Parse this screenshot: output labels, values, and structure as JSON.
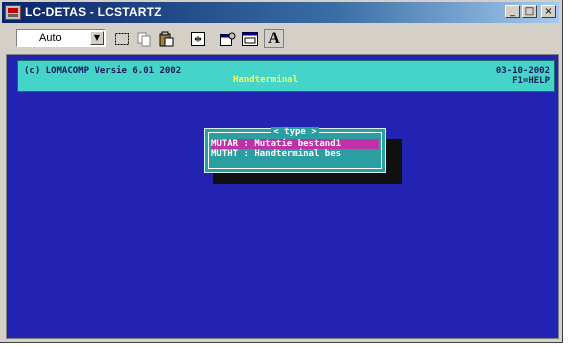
{
  "window": {
    "title": "LC-DETAS - LCSTARTZ",
    "minimize_label": "_",
    "maximize_label": "□",
    "close_label": "×"
  },
  "toolbar": {
    "font_size_value": "Auto",
    "combo_arrow": "▼",
    "buttons": [
      "select-icon",
      "copy-icon",
      "paste-icon",
      "fullscreen-icon",
      "properties-icon",
      "background-icon",
      "font-icon"
    ],
    "font_label": "A"
  },
  "header": {
    "copyright": "(c) LOMACOMP Versie 6.01 2002",
    "app_name": "Handterminal",
    "date": "03-10-2002",
    "help": "F1=HELP",
    "bg_color": "#44d4c8"
  },
  "menu": {
    "title": "< type >",
    "items": [
      {
        "label": "MUTAR : Mutatie bestand1",
        "selected": true
      },
      {
        "label": "MUTHT : Handterminal bes",
        "selected": false
      }
    ],
    "highlight_color": "#c030a8"
  },
  "console": {
    "bg_color": "#2323b3"
  }
}
